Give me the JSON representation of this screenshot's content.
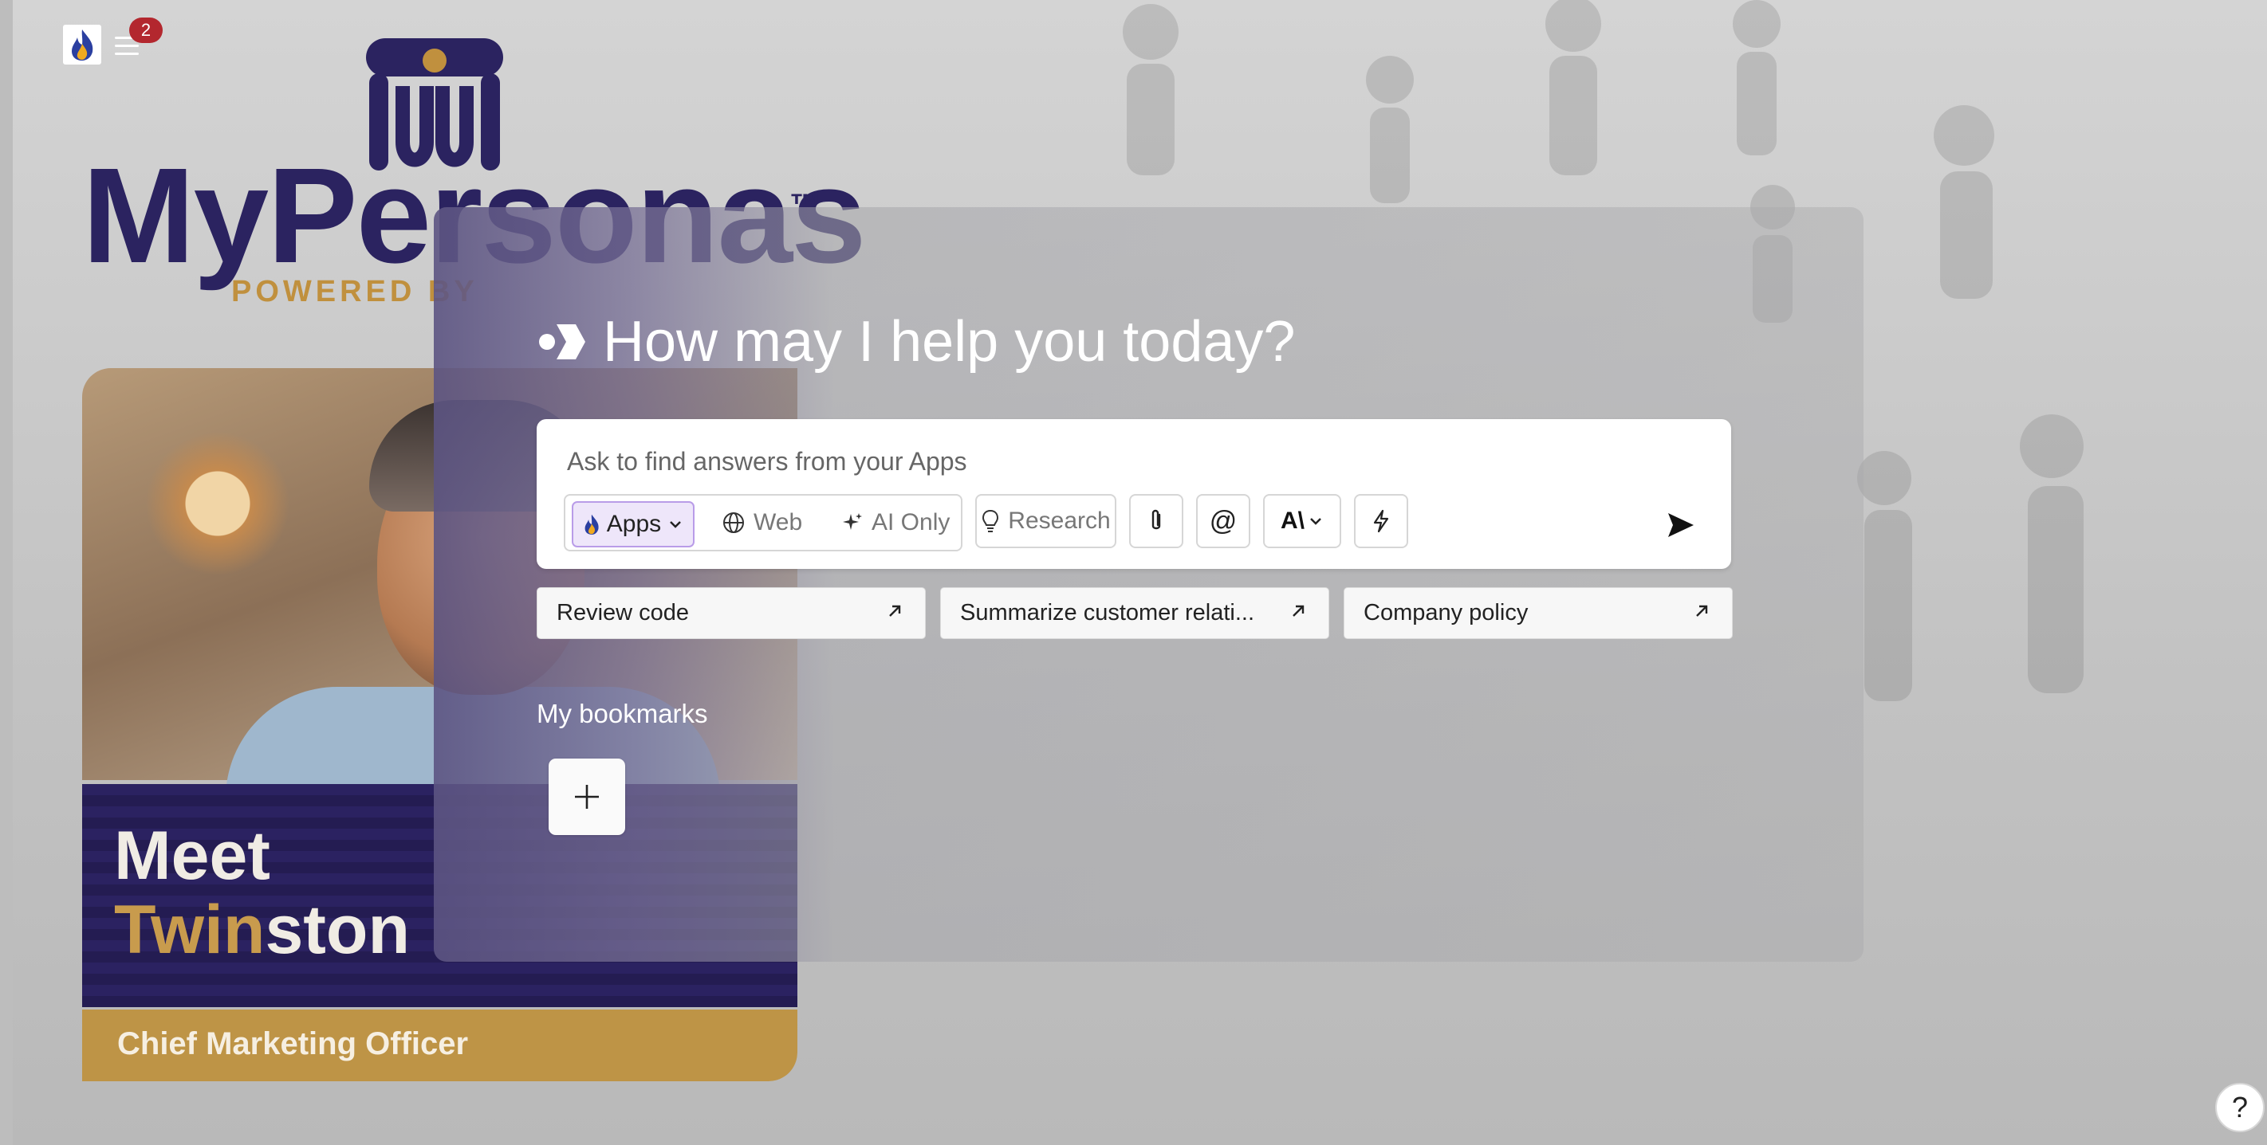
{
  "topbar": {
    "notification_count": "2",
    "app_logo_icon": "flame-icon",
    "menu_icon": "hamburger-menu-icon"
  },
  "brand": {
    "name": "MyPersonas",
    "trademark": "™",
    "tagline": "POWERED BY"
  },
  "persona": {
    "line1": "Meet",
    "name_part1": "Twin",
    "name_part2": "ston",
    "role": "Chief Marketing Officer"
  },
  "assistant": {
    "heading": "How may I help you today?",
    "input_placeholder": "Ask to find answers from your Apps",
    "modes": {
      "apps": "Apps",
      "web": "Web",
      "ai_only": "AI Only"
    },
    "tools": {
      "research": "Research",
      "mention_symbol": "@",
      "model_symbol": "A\\"
    }
  },
  "suggestions": [
    {
      "label": "Review code"
    },
    {
      "label": "Summarize customer relati..."
    },
    {
      "label": "Company policy"
    }
  ],
  "bookmarks": {
    "title": "My bookmarks",
    "add_symbol": "+"
  },
  "help": {
    "symbol": "?"
  },
  "colors": {
    "brand_navy": "#2b2360",
    "brand_gold": "#c0903e",
    "badge_red": "#b3272e",
    "apps_active_bg": "#eee6fa"
  }
}
